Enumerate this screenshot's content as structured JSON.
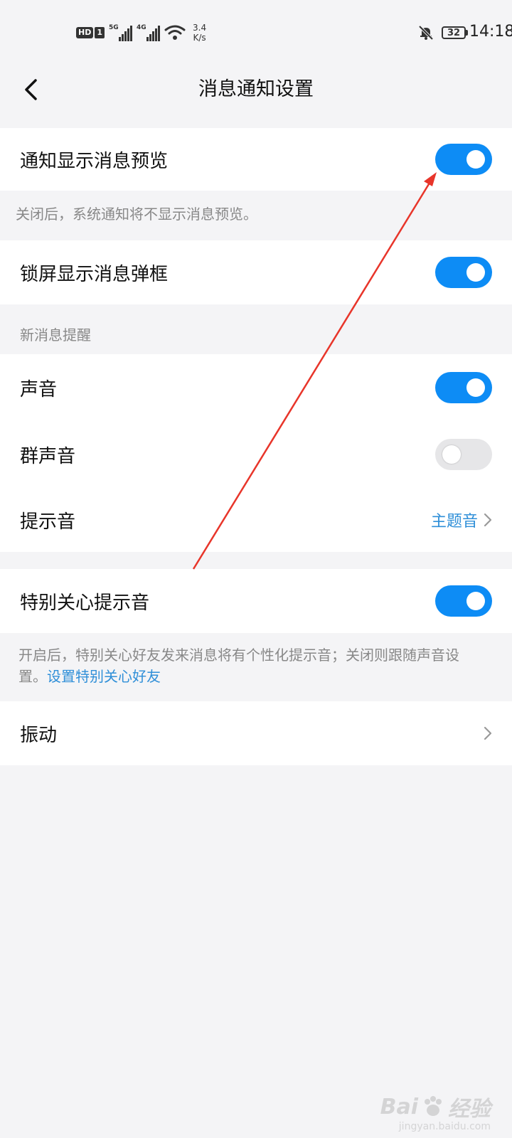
{
  "status_bar": {
    "hd": "HD",
    "sim": "1",
    "net1": "5G",
    "net2": "4G",
    "speed_value": "3.4",
    "speed_unit": "K/s",
    "battery": "32",
    "time": "14:18"
  },
  "header": {
    "title": "消息通知设置"
  },
  "settings": {
    "preview": {
      "label": "通知显示消息预览",
      "on": true
    },
    "preview_hint": "关闭后，系统通知将不显示消息预览。",
    "lockscreen": {
      "label": "锁屏显示消息弹框",
      "on": true
    },
    "section_new_msg": "新消息提醒",
    "sound": {
      "label": "声音",
      "on": true
    },
    "group_sound": {
      "label": "群声音",
      "on": false
    },
    "tone": {
      "label": "提示音",
      "value": "主题音"
    },
    "special_tone": {
      "label": "特别关心提示音",
      "on": true
    },
    "special_hint": "开启后，特别关心好友发来消息将有个性化提示音；关闭则跟随声音设置。",
    "special_hint_link": "设置特别关心好友",
    "vibration": {
      "label": "振动"
    }
  },
  "watermark": {
    "logo": "Bai",
    "logo_tail": "经验",
    "site": "jingyan.baidu.com"
  },
  "colors": {
    "accent": "#0d8cf5",
    "link": "#2f8fd8",
    "annotation_arrow": "#e8352a"
  }
}
